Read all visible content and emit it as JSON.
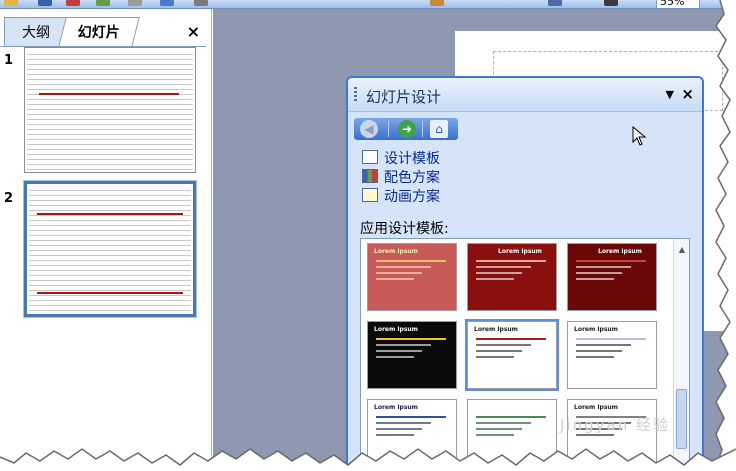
{
  "toolbar": {
    "zoom_value": "55%",
    "icons": [
      "open-icon",
      "save-icon",
      "print-icon",
      "copy-icon",
      "paste-icon",
      "undo-icon",
      "redo-icon",
      "chart-icon",
      "table-icon",
      "grid-icon"
    ]
  },
  "left_pane": {
    "tabs": [
      {
        "label": "大纲",
        "active": false
      },
      {
        "label": "幻灯片",
        "active": true
      }
    ],
    "close_label": "×",
    "slides": [
      {
        "number": "1",
        "selected": false
      },
      {
        "number": "2",
        "selected": true
      }
    ]
  },
  "task_pane": {
    "title": "幻灯片设计",
    "dropdown_label": "▼",
    "close_label": "×",
    "links": [
      {
        "label": "设计模板",
        "icon": "design-template-icon"
      },
      {
        "label": "配色方案",
        "icon": "color-scheme-icon"
      },
      {
        "label": "动画方案",
        "icon": "animation-scheme-icon"
      }
    ],
    "apply_label": "应用设计模板:",
    "templates": [
      {
        "title": "Lorem Ipsum",
        "bg": "#c85a5a",
        "fg": "#ffe9b5",
        "accent": "#e8c06a"
      },
      {
        "title": "Lorem Ipsum",
        "bg": "#8a0f0f",
        "fg": "#ffffff",
        "accent": "#f0a0a0"
      },
      {
        "title": "Lorem Ipsum",
        "bg": "#6a0808",
        "fg": "#ffffff",
        "accent": "#c84040"
      },
      {
        "title": "Lorem Ipsum",
        "bg": "#0a0a0a",
        "fg": "#ffffff",
        "accent": "#f0c030"
      },
      {
        "title": "Lorem Ipsum",
        "bg": "#ffffff",
        "fg": "#1a1a1a",
        "accent": "#a02020"
      },
      {
        "title": "Lorem Ipsum",
        "bg": "#ffffff",
        "fg": "#1a1a1a",
        "accent": "#b8c0e0"
      },
      {
        "title": "Lorem Ipsum",
        "bg": "#ffffff",
        "fg": "#1a1a4a",
        "accent": "#3050a0"
      },
      {
        "title": "",
        "bg": "#ffffff",
        "fg": "#1a4a2a",
        "accent": "#4a8a5a"
      },
      {
        "title": "Lorem Ipsum",
        "bg": "#ffffff",
        "fg": "#1a1a1a",
        "accent": "#808080"
      }
    ]
  },
  "watermark": "Jingyan 经验"
}
